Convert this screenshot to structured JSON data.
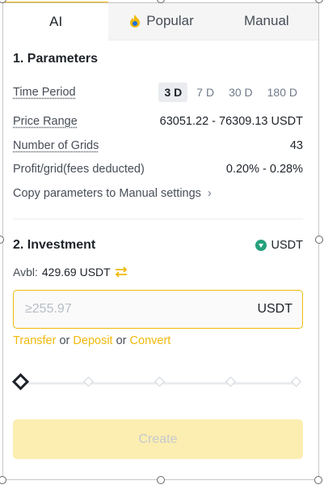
{
  "tabs": [
    {
      "label": "AI",
      "active": true
    },
    {
      "label": "Popular",
      "icon": "fire-icon"
    },
    {
      "label": "Manual"
    }
  ],
  "parameters": {
    "title": "1. Parameters",
    "time_period": {
      "label": "Time Period",
      "options": [
        "3 D",
        "7 D",
        "30 D",
        "180 D"
      ],
      "selected": "3 D"
    },
    "price_range": {
      "label": "Price Range",
      "value": "63051.22 - 76309.13 USDT"
    },
    "grids": {
      "label": "Number of Grids",
      "value": "43"
    },
    "profit": {
      "label": "Profit/grid(fees deducted)",
      "value": "0.20% - 0.28%"
    },
    "copy_link": "Copy parameters to Manual settings",
    "copy_arrow": "›"
  },
  "investment": {
    "title": "2. Investment",
    "currency": "USDT",
    "avbl_label": "Avbl:",
    "avbl_value": "429.69 USDT",
    "input_placeholder": "≥255.97",
    "input_unit": "USDT",
    "links": {
      "transfer": "Transfer",
      "or1": " or ",
      "deposit": "Deposit",
      "or2": " or ",
      "convert": "Convert"
    },
    "slider_value_percent": 0
  },
  "create_label": "Create",
  "colors": {
    "accent": "#f0b90b",
    "button_disabled_bg": "#fcedb1",
    "usdt_green": "#26a17b"
  }
}
